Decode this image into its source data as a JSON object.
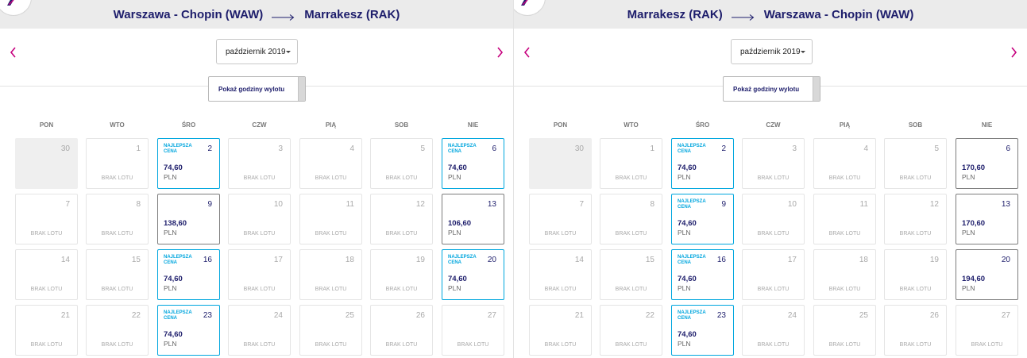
{
  "weekdays": [
    "PON",
    "WTO",
    "ŚRO",
    "CZW",
    "PIĄ",
    "SOB",
    "NIE"
  ],
  "colors": {
    "brand": "#1d1d6b",
    "best_price": "#00a6de",
    "nav_arrow": "#c6007e"
  },
  "panels": [
    {
      "route": {
        "from": "Warszawa - Chopin (WAW)",
        "to": "Marrakesz (RAK)"
      },
      "month_select": "październik 2019",
      "show_times_label": "Pokaż godziny wylotu",
      "prev_icon": "chevron-left-icon",
      "next_icon": "chevron-right-icon",
      "days": [
        {
          "day": "30",
          "state": "other"
        },
        {
          "day": "1",
          "state": "none",
          "label": "BRAK LOTU"
        },
        {
          "day": "2",
          "state": "best",
          "badge": "NAJLEPSZA CENA",
          "price": "74,60",
          "currency": "PLN"
        },
        {
          "day": "3",
          "state": "none",
          "label": "BRAK LOTU"
        },
        {
          "day": "4",
          "state": "none",
          "label": "BRAK LOTU"
        },
        {
          "day": "5",
          "state": "none",
          "label": "BRAK LOTU"
        },
        {
          "day": "6",
          "state": "best",
          "badge": "NAJLEPSZA CENA",
          "price": "74,60",
          "currency": "PLN"
        },
        {
          "day": "7",
          "state": "none",
          "label": "BRAK LOTU"
        },
        {
          "day": "8",
          "state": "none",
          "label": "BRAK LOTU"
        },
        {
          "day": "9",
          "state": "price",
          "price": "138,60",
          "currency": "PLN"
        },
        {
          "day": "10",
          "state": "none",
          "label": "BRAK LOTU"
        },
        {
          "day": "11",
          "state": "none",
          "label": "BRAK LOTU"
        },
        {
          "day": "12",
          "state": "none",
          "label": "BRAK LOTU"
        },
        {
          "day": "13",
          "state": "price",
          "price": "106,60",
          "currency": "PLN"
        },
        {
          "day": "14",
          "state": "none",
          "label": "BRAK LOTU"
        },
        {
          "day": "15",
          "state": "none",
          "label": "BRAK LOTU"
        },
        {
          "day": "16",
          "state": "best",
          "badge": "NAJLEPSZA CENA",
          "price": "74,60",
          "currency": "PLN"
        },
        {
          "day": "17",
          "state": "none",
          "label": "BRAK LOTU"
        },
        {
          "day": "18",
          "state": "none",
          "label": "BRAK LOTU"
        },
        {
          "day": "19",
          "state": "none",
          "label": "BRAK LOTU"
        },
        {
          "day": "20",
          "state": "best",
          "badge": "NAJLEPSZA CENA",
          "price": "74,60",
          "currency": "PLN"
        },
        {
          "day": "21",
          "state": "none",
          "label": "BRAK LOTU"
        },
        {
          "day": "22",
          "state": "none",
          "label": "BRAK LOTU"
        },
        {
          "day": "23",
          "state": "best",
          "badge": "NAJLEPSZA CENA",
          "price": "74,60",
          "currency": "PLN"
        },
        {
          "day": "24",
          "state": "none",
          "label": "BRAK LOTU"
        },
        {
          "day": "25",
          "state": "none",
          "label": "BRAK LOTU"
        },
        {
          "day": "26",
          "state": "none",
          "label": "BRAK LOTU"
        },
        {
          "day": "27",
          "state": "none",
          "label": "BRAK LOTU"
        }
      ]
    },
    {
      "route": {
        "from": "Marrakesz (RAK)",
        "to": "Warszawa - Chopin (WAW)"
      },
      "month_select": "październik 2019",
      "show_times_label": "Pokaż godziny wylotu",
      "prev_icon": "chevron-left-icon",
      "next_icon": "chevron-right-icon",
      "days": [
        {
          "day": "30",
          "state": "other"
        },
        {
          "day": "1",
          "state": "none",
          "label": "BRAK LOTU"
        },
        {
          "day": "2",
          "state": "best",
          "badge": "NAJLEPSZA CENA",
          "price": "74,60",
          "currency": "PLN"
        },
        {
          "day": "3",
          "state": "none",
          "label": "BRAK LOTU"
        },
        {
          "day": "4",
          "state": "none",
          "label": "BRAK LOTU"
        },
        {
          "day": "5",
          "state": "none",
          "label": "BRAK LOTU"
        },
        {
          "day": "6",
          "state": "price",
          "price": "170,60",
          "currency": "PLN"
        },
        {
          "day": "7",
          "state": "none",
          "label": "BRAK LOTU"
        },
        {
          "day": "8",
          "state": "none",
          "label": "BRAK LOTU"
        },
        {
          "day": "9",
          "state": "best",
          "badge": "NAJLEPSZA CENA",
          "price": "74,60",
          "currency": "PLN"
        },
        {
          "day": "10",
          "state": "none",
          "label": "BRAK LOTU"
        },
        {
          "day": "11",
          "state": "none",
          "label": "BRAK LOTU"
        },
        {
          "day": "12",
          "state": "none",
          "label": "BRAK LOTU"
        },
        {
          "day": "13",
          "state": "price",
          "price": "170,60",
          "currency": "PLN"
        },
        {
          "day": "14",
          "state": "none",
          "label": "BRAK LOTU"
        },
        {
          "day": "15",
          "state": "none",
          "label": "BRAK LOTU"
        },
        {
          "day": "16",
          "state": "best",
          "badge": "NAJLEPSZA CENA",
          "price": "74,60",
          "currency": "PLN"
        },
        {
          "day": "17",
          "state": "none",
          "label": "BRAK LOTU"
        },
        {
          "day": "18",
          "state": "none",
          "label": "BRAK LOTU"
        },
        {
          "day": "19",
          "state": "none",
          "label": "BRAK LOTU"
        },
        {
          "day": "20",
          "state": "price",
          "price": "194,60",
          "currency": "PLN"
        },
        {
          "day": "21",
          "state": "none",
          "label": "BRAK LOTU"
        },
        {
          "day": "22",
          "state": "none",
          "label": "BRAK LOTU"
        },
        {
          "day": "23",
          "state": "best",
          "badge": "NAJLEPSZA CENA",
          "price": "74,60",
          "currency": "PLN"
        },
        {
          "day": "24",
          "state": "none",
          "label": "BRAK LOTU"
        },
        {
          "day": "25",
          "state": "none",
          "label": "BRAK LOTU"
        },
        {
          "day": "26",
          "state": "none",
          "label": "BRAK LOTU"
        },
        {
          "day": "27",
          "state": "none",
          "label": "BRAK LOTU"
        }
      ]
    }
  ]
}
